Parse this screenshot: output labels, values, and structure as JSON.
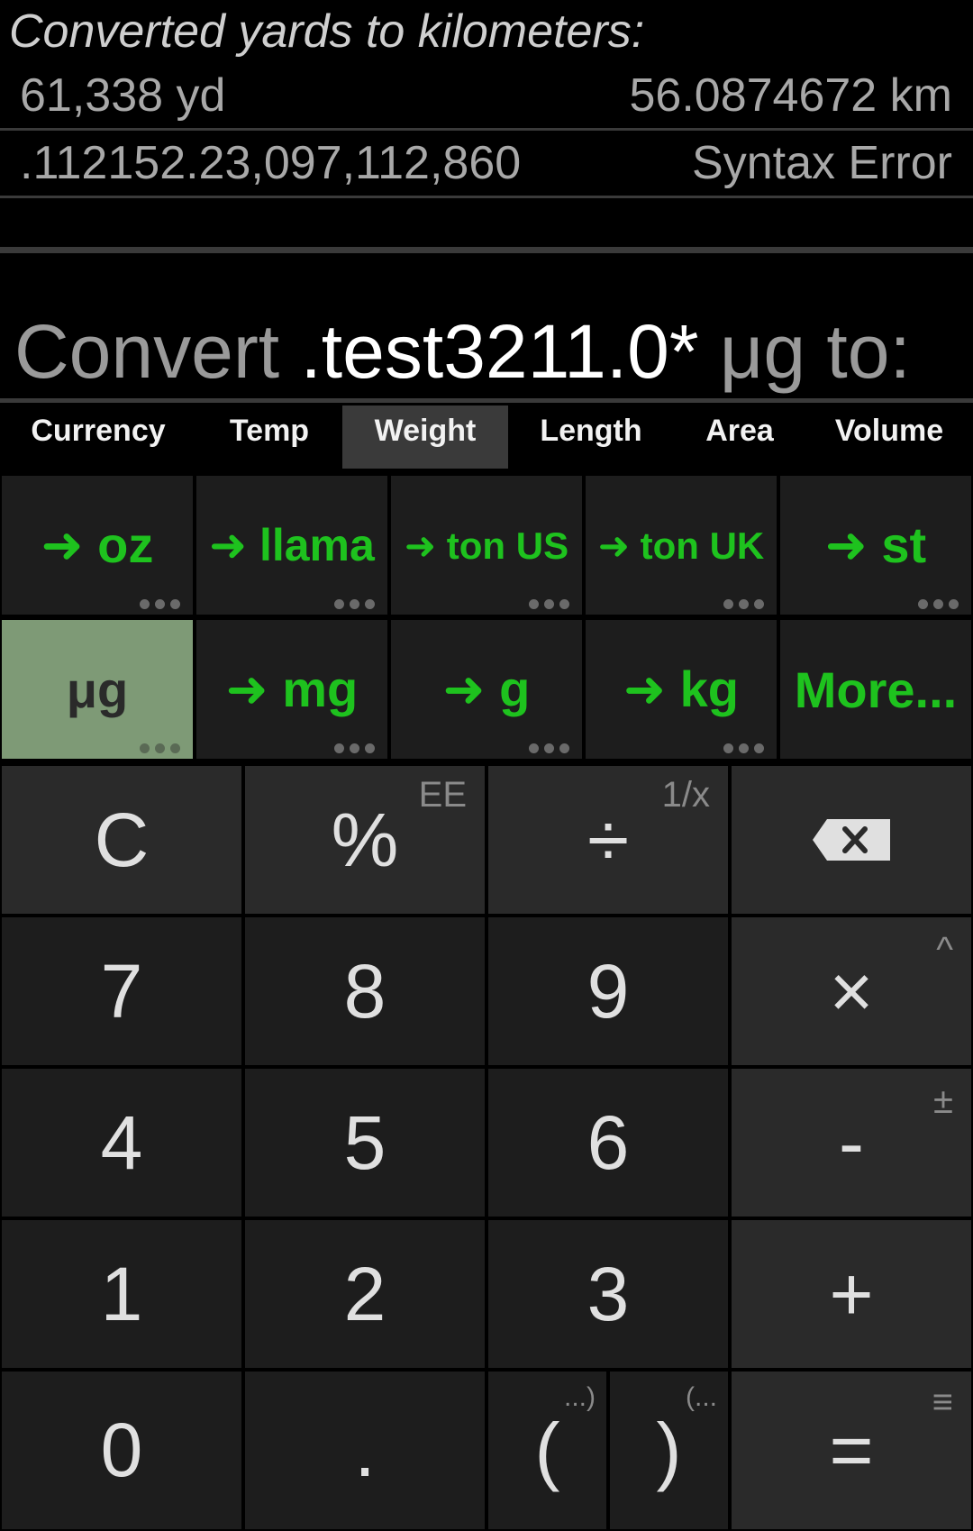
{
  "history": {
    "title": "Converted yards to kilometers:",
    "rows": [
      {
        "input": "61,338 yd",
        "result": "56.0874672 km"
      },
      {
        "input": ".112152.23,097,112,860",
        "result": "Syntax Error"
      }
    ]
  },
  "convert": {
    "prefix": "Convert",
    "value": ".test3211.0*",
    "unit": "μg",
    "suffix": "to:"
  },
  "tabs": [
    {
      "label": "Currency",
      "active": false
    },
    {
      "label": "Temp",
      "active": false
    },
    {
      "label": "Weight",
      "active": true
    },
    {
      "label": "Length",
      "active": false
    },
    {
      "label": "Area",
      "active": false
    },
    {
      "label": "Volume",
      "active": false
    }
  ],
  "units": {
    "row1": [
      {
        "label": "oz",
        "arrow": "➜"
      },
      {
        "label": "llama",
        "arrow": "➜"
      },
      {
        "label": "ton US",
        "arrow": "➜"
      },
      {
        "label": "ton UK",
        "arrow": "➜"
      },
      {
        "label": "st",
        "arrow": "➜"
      }
    ],
    "row2": [
      {
        "label": "μg",
        "selected": true
      },
      {
        "label": "mg",
        "arrow": "➜"
      },
      {
        "label": "g",
        "arrow": "➜"
      },
      {
        "label": "kg",
        "arrow": "➜"
      },
      {
        "label": "More..."
      }
    ]
  },
  "keypad": {
    "clear": "C",
    "percent": "%",
    "percent_secondary": "EE",
    "divide": "÷",
    "divide_secondary": "1/x",
    "backspace": "✕",
    "seven": "7",
    "eight": "8",
    "nine": "9",
    "multiply": "×",
    "multiply_secondary": "^",
    "four": "4",
    "five": "5",
    "six": "6",
    "minus": "-",
    "minus_secondary": "±",
    "one": "1",
    "two": "2",
    "three": "3",
    "plus": "+",
    "zero": "0",
    "dot": ".",
    "open_paren": "(",
    "open_paren_secondary": "...)",
    "close_paren": ")",
    "close_paren_secondary": "(...",
    "equals": "=",
    "equals_secondary": "≡"
  },
  "colors": {
    "accent_green": "#1ec21e",
    "selected_unit_bg": "#7e9a76",
    "background": "#000000",
    "key_bg": "#1d1d1d",
    "op_key_bg": "#2a2a2a"
  }
}
